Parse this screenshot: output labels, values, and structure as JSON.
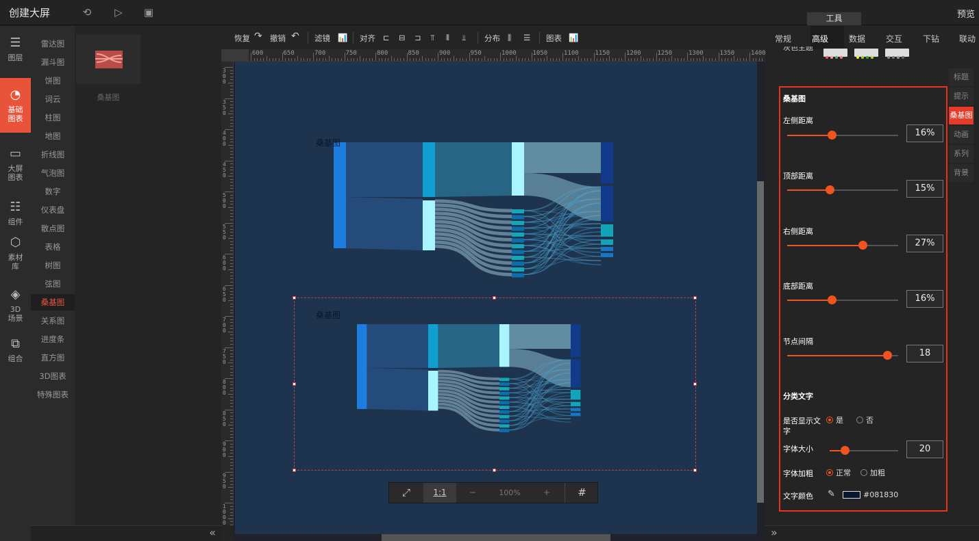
{
  "header": {
    "title": "创建大屏",
    "tool_tab": "工具",
    "preview": "预览"
  },
  "leftnav": [
    {
      "label": "图层",
      "icon": "layers-icon",
      "glyph": "☰"
    },
    {
      "label": "基础图表",
      "icon": "pie-chart-icon",
      "glyph": "◔"
    },
    {
      "label": "大屏图表",
      "icon": "monitor-chart-icon",
      "glyph": "▭"
    },
    {
      "label": "组件",
      "icon": "sliders-icon",
      "glyph": "☷"
    },
    {
      "label": "素材库",
      "icon": "hexagons-icon",
      "glyph": "⬡"
    },
    {
      "label": "3D场景",
      "icon": "cube-icon",
      "glyph": "◈"
    },
    {
      "label": "组合",
      "icon": "combine-icon",
      "glyph": "⧉"
    }
  ],
  "categories": [
    "雷达图",
    "漏斗图",
    "饼图",
    "词云",
    "柱图",
    "地图",
    "折线图",
    "气泡图",
    "数字",
    "仪表盘",
    "散点图",
    "表格",
    "树图",
    "弦图",
    "桑基图",
    "关系图",
    "进度条",
    "直方图",
    "3D图表",
    "特殊图表"
  ],
  "active_category": "桑基图",
  "thumbnail_label": "桑基图",
  "toolbar": {
    "redo": "恢复",
    "undo": "撤销",
    "filter": "滤镜",
    "align": "对齐",
    "distribute": "分布",
    "chart": "图表"
  },
  "ruler": {
    "top": [
      "600",
      "650",
      "700",
      "750",
      "800",
      "850",
      "900",
      "950",
      "1000",
      "1050",
      "1100",
      "1150",
      "1200",
      "1250",
      "1300",
      "1350",
      "1400"
    ],
    "left": [
      "300",
      "350",
      "400",
      "450",
      "500",
      "550",
      "600",
      "650",
      "700",
      "750",
      "800",
      "850",
      "900",
      "950",
      "1000"
    ]
  },
  "charts": [
    {
      "title": "桑基图"
    },
    {
      "title": "桑基图"
    }
  ],
  "zoombar": {
    "fit": "⤢",
    "one_to_one": "1:1",
    "minus": "−",
    "zoom": "100%",
    "plus": "+",
    "grid": "#"
  },
  "rightpanel": {
    "tabs": [
      "常规",
      "高级",
      "数据",
      "交互",
      "下钻",
      "联动"
    ],
    "active_tab": "高级",
    "theme_label": "灰色主题",
    "subtabs": [
      "标题",
      "提示",
      "桑基图",
      "动画",
      "系列",
      "背景"
    ],
    "active_subtab": "桑基图",
    "section_title": "桑基图",
    "left": {
      "label": "左侧距离",
      "value": "16%",
      "level": 0.4
    },
    "top": {
      "label": "顶部距离",
      "value": "15%",
      "level": 0.38
    },
    "right": {
      "label": "右侧距离",
      "value": "27%",
      "level": 0.68
    },
    "bottom": {
      "label": "底部距离",
      "value": "16%",
      "level": 0.4
    },
    "gap": {
      "label": "节点间隔",
      "value": "18",
      "level": 0.9
    },
    "class_text": "分类文字",
    "show_text_label": "是否显示文字",
    "show_yes": "是",
    "show_no": "否",
    "font_size": {
      "label": "字体大小",
      "value": "20",
      "level": 0.22
    },
    "bold_label": "字体加粗",
    "bold_normal": "正常",
    "bold_bold": "加粗",
    "color_label": "文字颜色",
    "color_value": "#081830"
  }
}
